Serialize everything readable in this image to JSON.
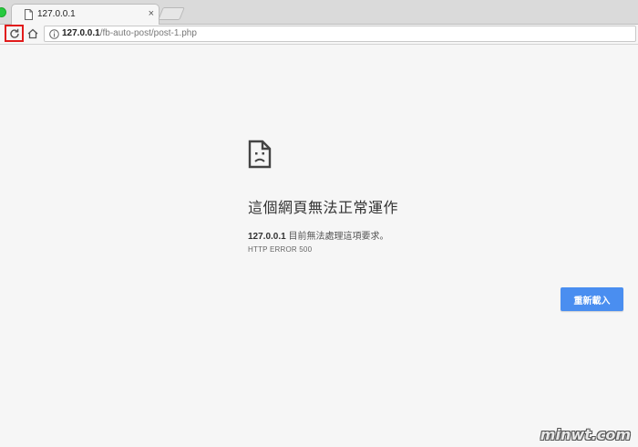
{
  "tab": {
    "title": "127.0.0.1",
    "close_glyph": "×"
  },
  "toolbar": {
    "url_host": "127.0.0.1",
    "url_path": "/fb-auto-post/post-1.php"
  },
  "error": {
    "title": "這個網頁無法正常運作",
    "host": "127.0.0.1",
    "message": " 目前無法處理這項要求。",
    "code": "HTTP ERROR 500",
    "reload_label": "重新載入"
  },
  "watermark": {
    "text": "minwt.com"
  },
  "colors": {
    "accent": "#4a8ef0",
    "highlight_box": "#e11b1b",
    "page_background": "#f6f6f6"
  },
  "icons": {
    "tab": "document-icon",
    "reload": "reload-icon",
    "home": "home-icon",
    "info": "info-icon",
    "error": "sad-document-icon"
  }
}
